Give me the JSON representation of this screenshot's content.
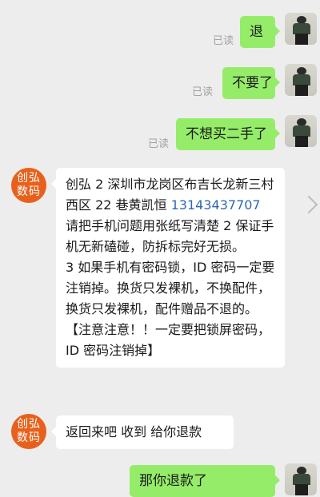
{
  "read_label": "已读",
  "messages": [
    {
      "text": "退",
      "read": "已读"
    },
    {
      "text": "不要了",
      "read": "已读"
    },
    {
      "text": "不想买二手了",
      "read": "已读"
    }
  ],
  "shop": {
    "avatar_line1": "创弘",
    "avatar_line2": "数码"
  },
  "incoming": [
    {
      "before_phone": "创弘 2 深圳市龙岗区布吉长龙新三村西区 22 巷黄凯恒 ",
      "phone": "13143437707",
      "after_phone": "  请把手机问题用张纸写清楚 2 保证手机无新磕碰，防拆标完好无损。",
      "para2": "3 如果手机有密码锁，ID 密码一定要注销掉。换货只发裸机，不换配件，换货只发裸机，配件赠品不退的。【注意注意！！一定要把锁屏密码，ID 密码注销掉】"
    },
    {
      "text": "返回来吧  收到 给你退款"
    }
  ],
  "partial_outgoing": "那你退款了"
}
